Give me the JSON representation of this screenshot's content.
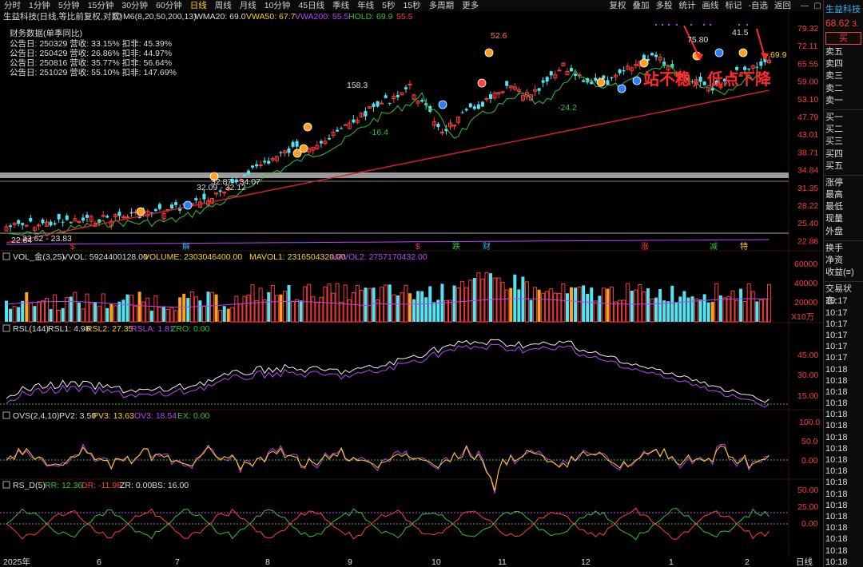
{
  "toolbar": {
    "periods": [
      "分时",
      "1分钟",
      "5分钟",
      "15分钟",
      "30分钟",
      "60分钟",
      "日线",
      "周线",
      "月线",
      "10分钟",
      "45日线",
      "季线",
      "年线",
      "5秒",
      "15秒",
      "多周期",
      "更多"
    ],
    "active": "日线",
    "right_items": [
      "复权",
      "叠加",
      "多股",
      "统计",
      "画线",
      "标记",
      "-自选",
      "返回"
    ]
  },
  "main_panel": {
    "legend_name": "生益科技(日线,等比前复权,对数)",
    "legend_m6": "M6(8,20,50,200,13)",
    "wma20": "WMA20: 69.0",
    "vwa50": "VWA50: 67.7",
    "vwa200": "VWA200: 55.5",
    "hold": "HOLD: 69.9",
    "hold_extra": "55.5",
    "finance_title": "财务数据(单季同比)",
    "finance_rows": [
      "公告日: 250329  营收: 33.15%  扣非: 45.39%",
      "公告日: 250429  营收: 26.86%  扣非: 44.97%",
      "公告日: 250816  营收: 35.77%  扣非: 56.64%",
      "公告日: 251029  营收: 55.10%  扣非: 147.69%"
    ],
    "annotation": "站不稳，低点下降",
    "price_labels": [
      "158.3",
      "-16.4",
      "52.6",
      "-24.2",
      "75.80",
      "41.5",
      "69.9",
      "32.09 - 32.12",
      "32.87 - 34.07",
      "22.84",
      "23.62 - 23.83"
    ],
    "y_ticks": [
      "79.32",
      "72.11",
      "65.55",
      "59.00",
      "53.10",
      "47.79",
      "43.01",
      "38.71",
      "34.84",
      "31.35",
      "28.22",
      "25.40",
      "22.86"
    ],
    "event_markers": [
      "$",
      "解",
      "$",
      "跌",
      "财",
      "涨",
      "减",
      "特"
    ]
  },
  "volume_panel": {
    "legend": "VOL_金(3,25)",
    "vvol": "VVOL: 5924400128.00",
    "volume": "VOLUME: 2303046400.00",
    "mavol1": "MAVOL1: 2316504320.00",
    "mavol2": "MAVOL2: 2757170432.00",
    "y_ticks": [
      "60000",
      "40000",
      "20000"
    ],
    "unit": "X10万"
  },
  "rsl_panel": {
    "legend": "RSL(144)",
    "rsl1": "RSL1: 4.98",
    "rsl2": "RSL2: 27.35",
    "rsla": "RSLA: 1.81",
    "zro": "ZRO: 0.00",
    "y_ticks": [
      "45.00",
      "30.00",
      "15.00"
    ]
  },
  "ovs_panel": {
    "legend": "OVS(2,4,10)",
    "pv2": "PV2: 3.50",
    "pv3": "PV3: 13.63",
    "ov3": "OV3: 18.54",
    "ex": "EX: 0.00",
    "y_ticks": [
      "100.0",
      "50.0",
      "0.00"
    ]
  },
  "rsd_panel": {
    "legend": "RS_D(5)",
    "rr": "RR: 12.36",
    "dr": "DR: -11.98",
    "zr": "ZR: 0.00",
    "bs": "BS: 16.00",
    "y_ticks": [
      "50.00",
      "25.00",
      "0.00"
    ]
  },
  "x_axis": {
    "labels": [
      "2025年",
      "6",
      "7",
      "8",
      "9",
      "10",
      "11",
      "12",
      "1",
      "2"
    ],
    "right": "日线"
  },
  "sidebar": {
    "name": "生益科技",
    "price": "68.62",
    "price_extra": "3.",
    "buy": "买",
    "order_book": [
      "卖五",
      "卖四",
      "卖三",
      "卖二",
      "卖一",
      "买一",
      "买二",
      "买三",
      "买四",
      "买五"
    ],
    "stats": [
      "涨停",
      "最高",
      "最低",
      "现量",
      "外盘",
      "换手",
      "净资",
      "收益(≡)"
    ],
    "trade_status": "交易状态:",
    "times": [
      "10:17",
      "10:17",
      "10:17",
      "10:17",
      "10:17",
      "10:17",
      "10:18",
      "10:18",
      "10:18",
      "10:18",
      "10:18",
      "10:18",
      "10:18",
      "10:18",
      "10:18",
      "10:18",
      "10:18",
      "10:18",
      "10:18",
      "10:18",
      "10:18",
      "10:18",
      "10:18",
      "10:18"
    ]
  },
  "colors": {
    "up": "#ff3b3b",
    "down": "#54e3f2",
    "yellow": "#ffd400",
    "purple": "#c040ff",
    "green": "#2ec42e",
    "accent_blue": "#39b5e8"
  }
}
